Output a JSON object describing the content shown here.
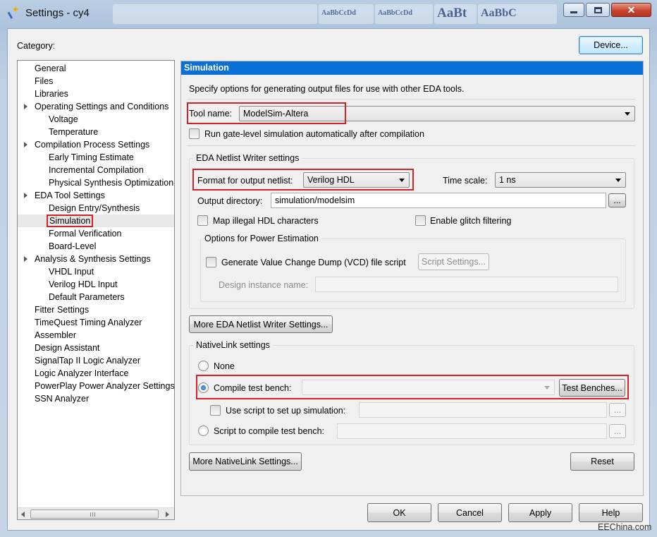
{
  "window": {
    "title": "Settings - cy4",
    "background_ribbon_samples": [
      "AaBbCcDd",
      "AaBbCcDd",
      "AaBbCcDd",
      "AaBbCcDd",
      "AaBt",
      "AaBbC"
    ]
  },
  "category_label": "Category:",
  "device_button": "Device...",
  "tree": {
    "items": [
      {
        "label": "General",
        "level": 0,
        "expanded": false
      },
      {
        "label": "Files",
        "level": 0,
        "expanded": false
      },
      {
        "label": "Libraries",
        "level": 0,
        "expanded": false
      },
      {
        "label": "Operating Settings and Conditions",
        "level": 0,
        "expanded": true
      },
      {
        "label": "Voltage",
        "level": 1
      },
      {
        "label": "Temperature",
        "level": 1
      },
      {
        "label": "Compilation Process Settings",
        "level": 0,
        "expanded": true
      },
      {
        "label": "Early Timing Estimate",
        "level": 1
      },
      {
        "label": "Incremental Compilation",
        "level": 1
      },
      {
        "label": "Physical Synthesis Optimization",
        "level": 1
      },
      {
        "label": "EDA Tool Settings",
        "level": 0,
        "expanded": true
      },
      {
        "label": "Design Entry/Synthesis",
        "level": 1
      },
      {
        "label": "Simulation",
        "level": 1,
        "selected": true
      },
      {
        "label": "Formal Verification",
        "level": 1
      },
      {
        "label": "Board-Level",
        "level": 1
      },
      {
        "label": "Analysis & Synthesis Settings",
        "level": 0,
        "expanded": true
      },
      {
        "label": "VHDL Input",
        "level": 1
      },
      {
        "label": "Verilog HDL Input",
        "level": 1
      },
      {
        "label": "Default Parameters",
        "level": 1
      },
      {
        "label": "Fitter Settings",
        "level": 0
      },
      {
        "label": "TimeQuest Timing Analyzer",
        "level": 0
      },
      {
        "label": "Assembler",
        "level": 0
      },
      {
        "label": "Design Assistant",
        "level": 0
      },
      {
        "label": "SignalTap II Logic Analyzer",
        "level": 0
      },
      {
        "label": "Logic Analyzer Interface",
        "level": 0
      },
      {
        "label": "PowerPlay Power Analyzer Settings",
        "level": 0
      },
      {
        "label": "SSN Analyzer",
        "level": 0
      }
    ]
  },
  "panel": {
    "header": "Simulation",
    "description": "Specify options for generating output files for use with other EDA tools.",
    "tool_name_label": "Tool name:",
    "tool_name_value": "ModelSim-Altera",
    "run_gate_level_label": "Run gate-level simulation automatically after compilation",
    "run_gate_level_checked": false,
    "eda_netlist": {
      "group_title": "EDA Netlist Writer settings",
      "format_label": "Format for output netlist:",
      "format_value": "Verilog HDL",
      "time_scale_label": "Time scale:",
      "time_scale_value": "1 ns",
      "output_dir_label": "Output directory:",
      "output_dir_value": "simulation/modelsim",
      "browse_label": "...",
      "map_illegal_label": "Map illegal HDL characters",
      "map_illegal_checked": false,
      "glitch_label": "Enable glitch filtering",
      "glitch_checked": false,
      "power": {
        "group_title": "Options for Power Estimation",
        "vcd_label": "Generate Value Change Dump (VCD) file script",
        "vcd_checked": false,
        "script_settings_button": "Script Settings...",
        "design_instance_label": "Design instance name:",
        "design_instance_value": ""
      }
    },
    "more_eda_button": "More EDA Netlist Writer Settings...",
    "nativelink": {
      "group_title": "NativeLink settings",
      "none_label": "None",
      "compile_tb_label": "Compile test bench:",
      "compile_tb_value": "",
      "test_benches_button": "Test Benches...",
      "use_script_label": "Use script to set up simulation:",
      "use_script_value": "",
      "script_compile_label": "Script to compile test bench:",
      "script_compile_value": "",
      "selected_option": "Compile test bench:",
      "browse_label": "..."
    },
    "more_nativelink_button": "More NativeLink Settings...",
    "reset_button": "Reset"
  },
  "footer": {
    "ok": "OK",
    "cancel": "Cancel",
    "apply": "Apply",
    "help": "Help"
  },
  "watermark": "EEChina.com",
  "colors": {
    "selection_header": "#0a6fd6",
    "highlight_box": "#d2232a",
    "close_button": "#c8452f"
  }
}
